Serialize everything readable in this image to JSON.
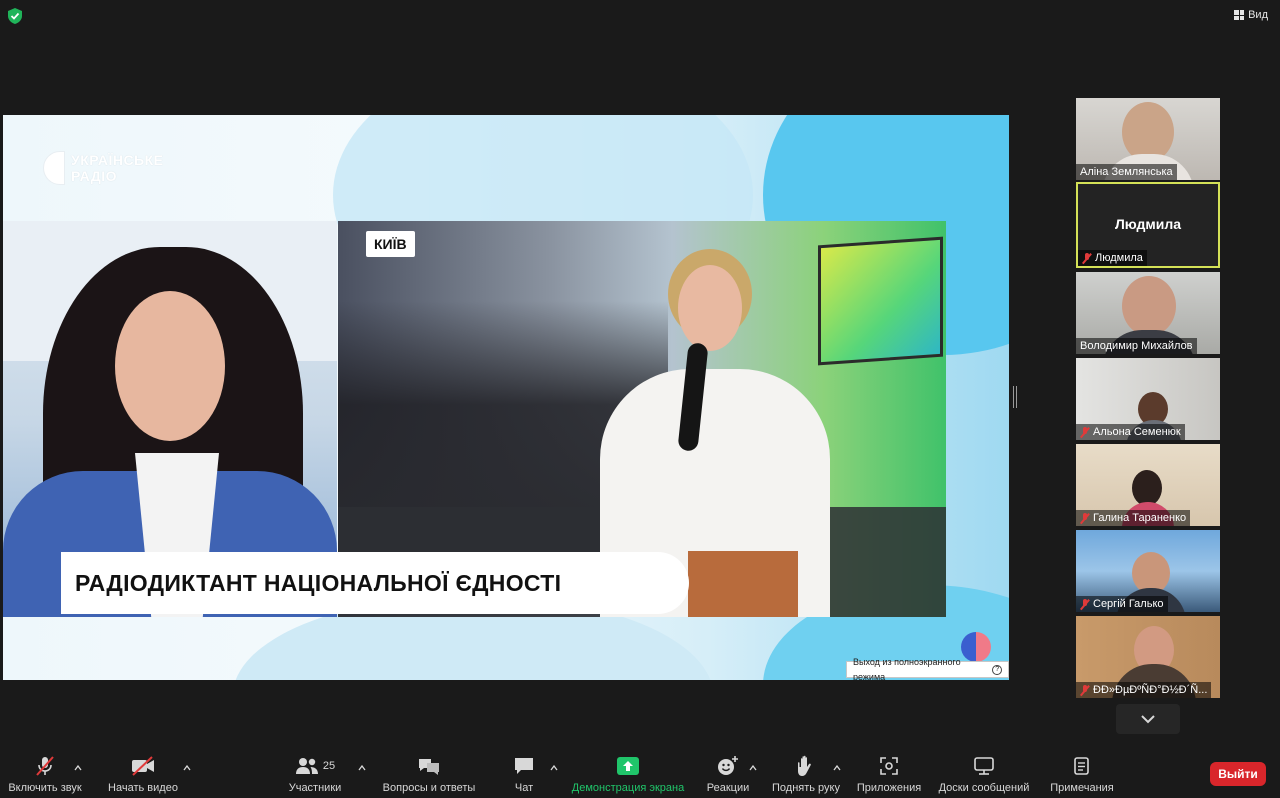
{
  "topbar": {
    "view_label": "Вид"
  },
  "share": {
    "logo_line1": "УКРАЇНСЬКЕ",
    "logo_line2": "РАДІО",
    "city": "КИЇВ",
    "banner": "РАДІОДИКТАНТ НАЦІОНАЛЬНОЇ ЄДНОСТІ",
    "exit_fullscreen": "Выход из полноэкранного режима"
  },
  "participants": [
    {
      "name": "Аліна Землянська",
      "muted": false
    },
    {
      "name": "Людмила",
      "muted": true,
      "active": true,
      "display": "Людмила"
    },
    {
      "name": "Володимир Михайлов",
      "muted": false
    },
    {
      "name": "Альона Семенюк",
      "muted": true
    },
    {
      "name": "Галина Тараненко",
      "muted": true
    },
    {
      "name": "Сергій Галько",
      "muted": true
    },
    {
      "name": "ÐÐ»ÐµÐºÑÐ°Ð½Ð´Ñ...",
      "muted": true
    }
  ],
  "toolbar": {
    "audio": "Включить звук",
    "video": "Начать видео",
    "participants": "Участники",
    "participants_count": "25",
    "qa": "Вопросы и ответы",
    "chat": "Чат",
    "share": "Демонстрация экрана",
    "reactions": "Реакции",
    "raise_hand": "Поднять руку",
    "apps": "Приложения",
    "whiteboards": "Доски сообщений",
    "notes": "Примечания",
    "leave": "Выйти"
  },
  "colors": {
    "share_green": "#20c56a",
    "active_border": "#d4e157",
    "leave_red": "#d9262b",
    "mute_red": "#e03a3a"
  }
}
